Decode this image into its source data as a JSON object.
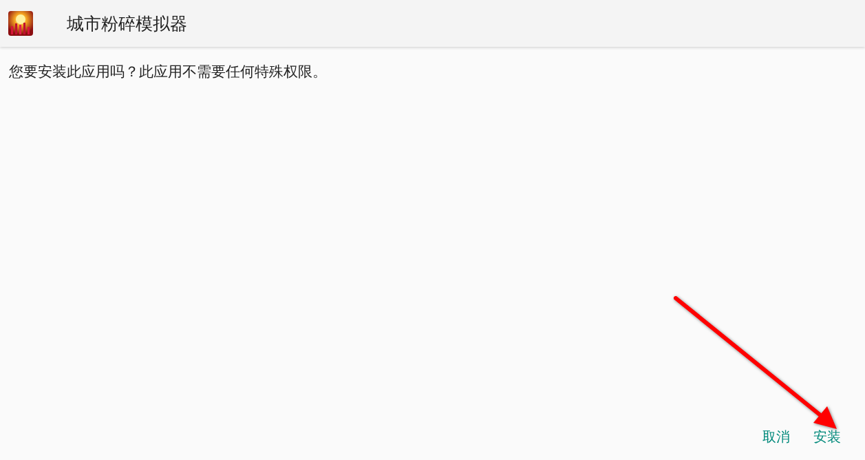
{
  "header": {
    "title": "城市粉碎模拟器"
  },
  "message": "您要安装此应用吗？此应用不需要任何特殊权限。",
  "buttons": [
    {
      "label": "取消"
    },
    {
      "label": "安装"
    }
  ]
}
